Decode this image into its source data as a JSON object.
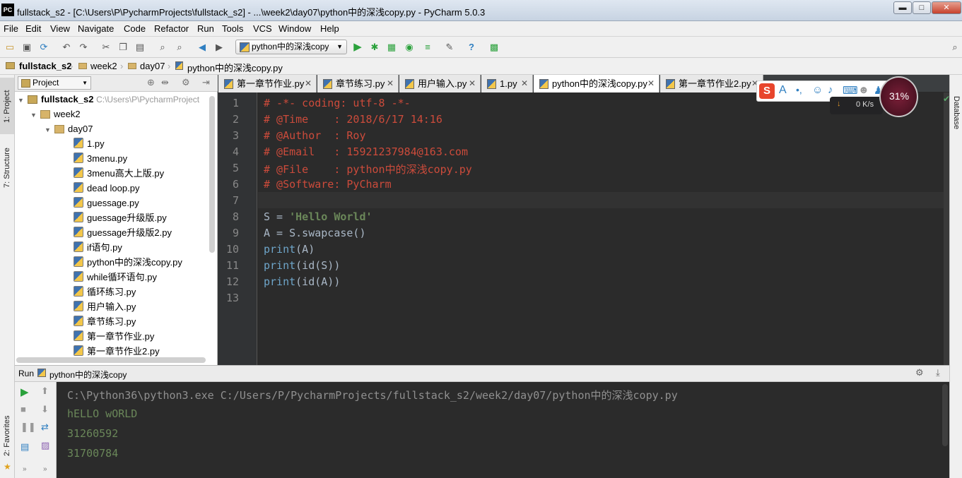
{
  "window": {
    "title": "fullstack_s2 - [C:\\Users\\P\\PycharmProjects\\fullstack_s2] - ...\\week2\\day07\\python中的深浅copy.py - PyCharm 5.0.3",
    "logo_text": "PC",
    "minimize": "▬",
    "maximize": "□",
    "close": "✕"
  },
  "menu": [
    "File",
    "Edit",
    "View",
    "Navigate",
    "Code",
    "Refactor",
    "Run",
    "Tools",
    "VCS",
    "Window",
    "Help"
  ],
  "toolbar": {
    "run_config": "python中的深浅copy",
    "icons": [
      "open-folder-icon",
      "save-icon",
      "sync-icon",
      "undo-icon",
      "redo-icon",
      "cut-icon",
      "copy-icon",
      "paste-icon",
      "find-icon",
      "replace-icon",
      "back-icon",
      "forward-icon",
      "run-icon",
      "debug-icon",
      "coverage-icon",
      "profile-icon",
      "build-icon",
      "settings-icon",
      "help-icon",
      "vcs-icon",
      "search-everywhere-icon"
    ]
  },
  "breadcrumb": [
    "fullstack_s2",
    "week2",
    "day07",
    "python中的深浅copy.py"
  ],
  "left_stripe": {
    "project": "1: Project",
    "structure": "7: Structure",
    "favorites": "2: Favorites"
  },
  "project_pane": {
    "view_selector": "Project",
    "root_name": "fullstack_s2",
    "root_path": "C:\\Users\\P\\PycharmProject",
    "folders": [
      "week2",
      "day07"
    ],
    "files": [
      "1.py",
      "3menu.py",
      "3menu高大上版.py",
      "dead loop.py",
      "guessage.py",
      "guessage升级版.py",
      "guessage升级版2.py",
      "if语句.py",
      "python中的深浅copy.py",
      "while循环语句.py",
      "循环练习.py",
      "用户输入.py",
      "章节练习.py",
      "第一章节作业.py",
      "第一章节作业2.py"
    ]
  },
  "editor_tabs": [
    {
      "label": "第一章节作业.py",
      "active": false
    },
    {
      "label": "章节练习.py",
      "active": false
    },
    {
      "label": "用户输入.py",
      "active": false
    },
    {
      "label": "1.py",
      "active": false
    },
    {
      "label": "python中的深浅copy.py",
      "active": true
    },
    {
      "label": "第一章节作业2.py",
      "active": false
    }
  ],
  "editor": {
    "line_numbers": [
      "1",
      "2",
      "3",
      "4",
      "5",
      "6",
      "7",
      "8",
      "9",
      "10",
      "11",
      "12",
      "13"
    ],
    "lines": {
      "l1": "# -*- coding: utf-8 -*-",
      "l2": "# @Time    : 2018/6/17 14:16",
      "l3": "# @Author  : Roy",
      "l4": "# @Email   : 15921237984@163.com",
      "l5": "# @File    : python中的深浅copy.py",
      "l6": "# @Software: PyCharm",
      "l8_var": "S = ",
      "l8_str": "'Hello World'",
      "l9": "A = S.swapcase()",
      "l10_kw": "print",
      "l10_rest": "(A)",
      "l11_kw": "print",
      "l11_rest": "(id(S))",
      "l12_kw": "print",
      "l12_rest": "(id(A))"
    }
  },
  "right_stripe": {
    "database": "Database"
  },
  "run_panel": {
    "label": "Run",
    "config_name": "python中的深浅copy",
    "output": [
      "C:\\Python36\\python3.exe C:/Users/P/PycharmProjects/fullstack_s2/week2/day07/python中的深浅copy.py",
      "hELLO wORLD",
      "31260592",
      "31700784"
    ]
  },
  "overlay": {
    "net_speed": "0 K/s",
    "net_percent": "31%",
    "ime_logo": "S"
  }
}
